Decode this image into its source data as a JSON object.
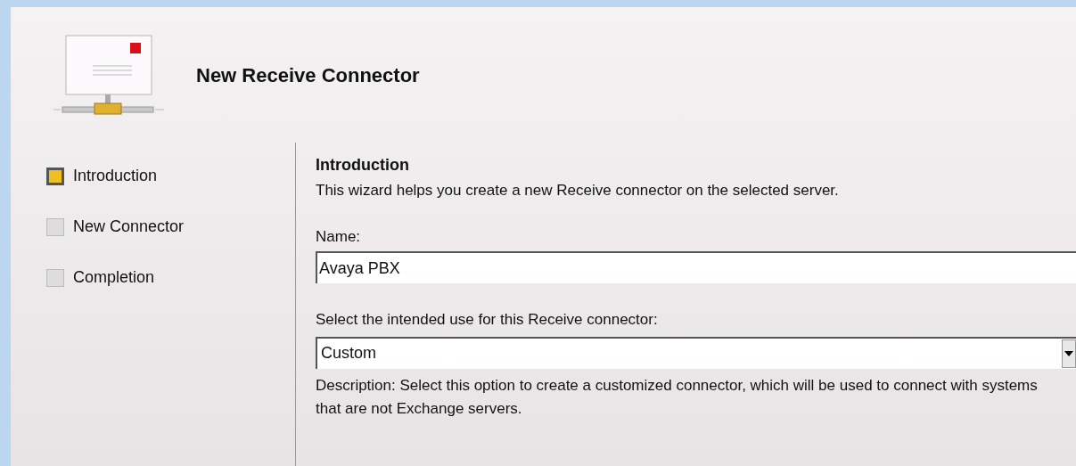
{
  "window": {
    "title": "New Receive Connector"
  },
  "steps": [
    {
      "label": "Introduction",
      "selected": true
    },
    {
      "label": "New Connector",
      "selected": false
    },
    {
      "label": "Completion",
      "selected": false
    }
  ],
  "page": {
    "heading": "Introduction",
    "intro": "This wizard helps you create a new Receive connector on the selected server.",
    "name_field": {
      "label": "Name:",
      "value": "Avaya PBX"
    },
    "use_field": {
      "label": "Select the intended use for this Receive connector:",
      "value": "Custom"
    },
    "description": "Description: Select this option to create a customized connector, which will be used to connect with systems that are not Exchange servers."
  }
}
